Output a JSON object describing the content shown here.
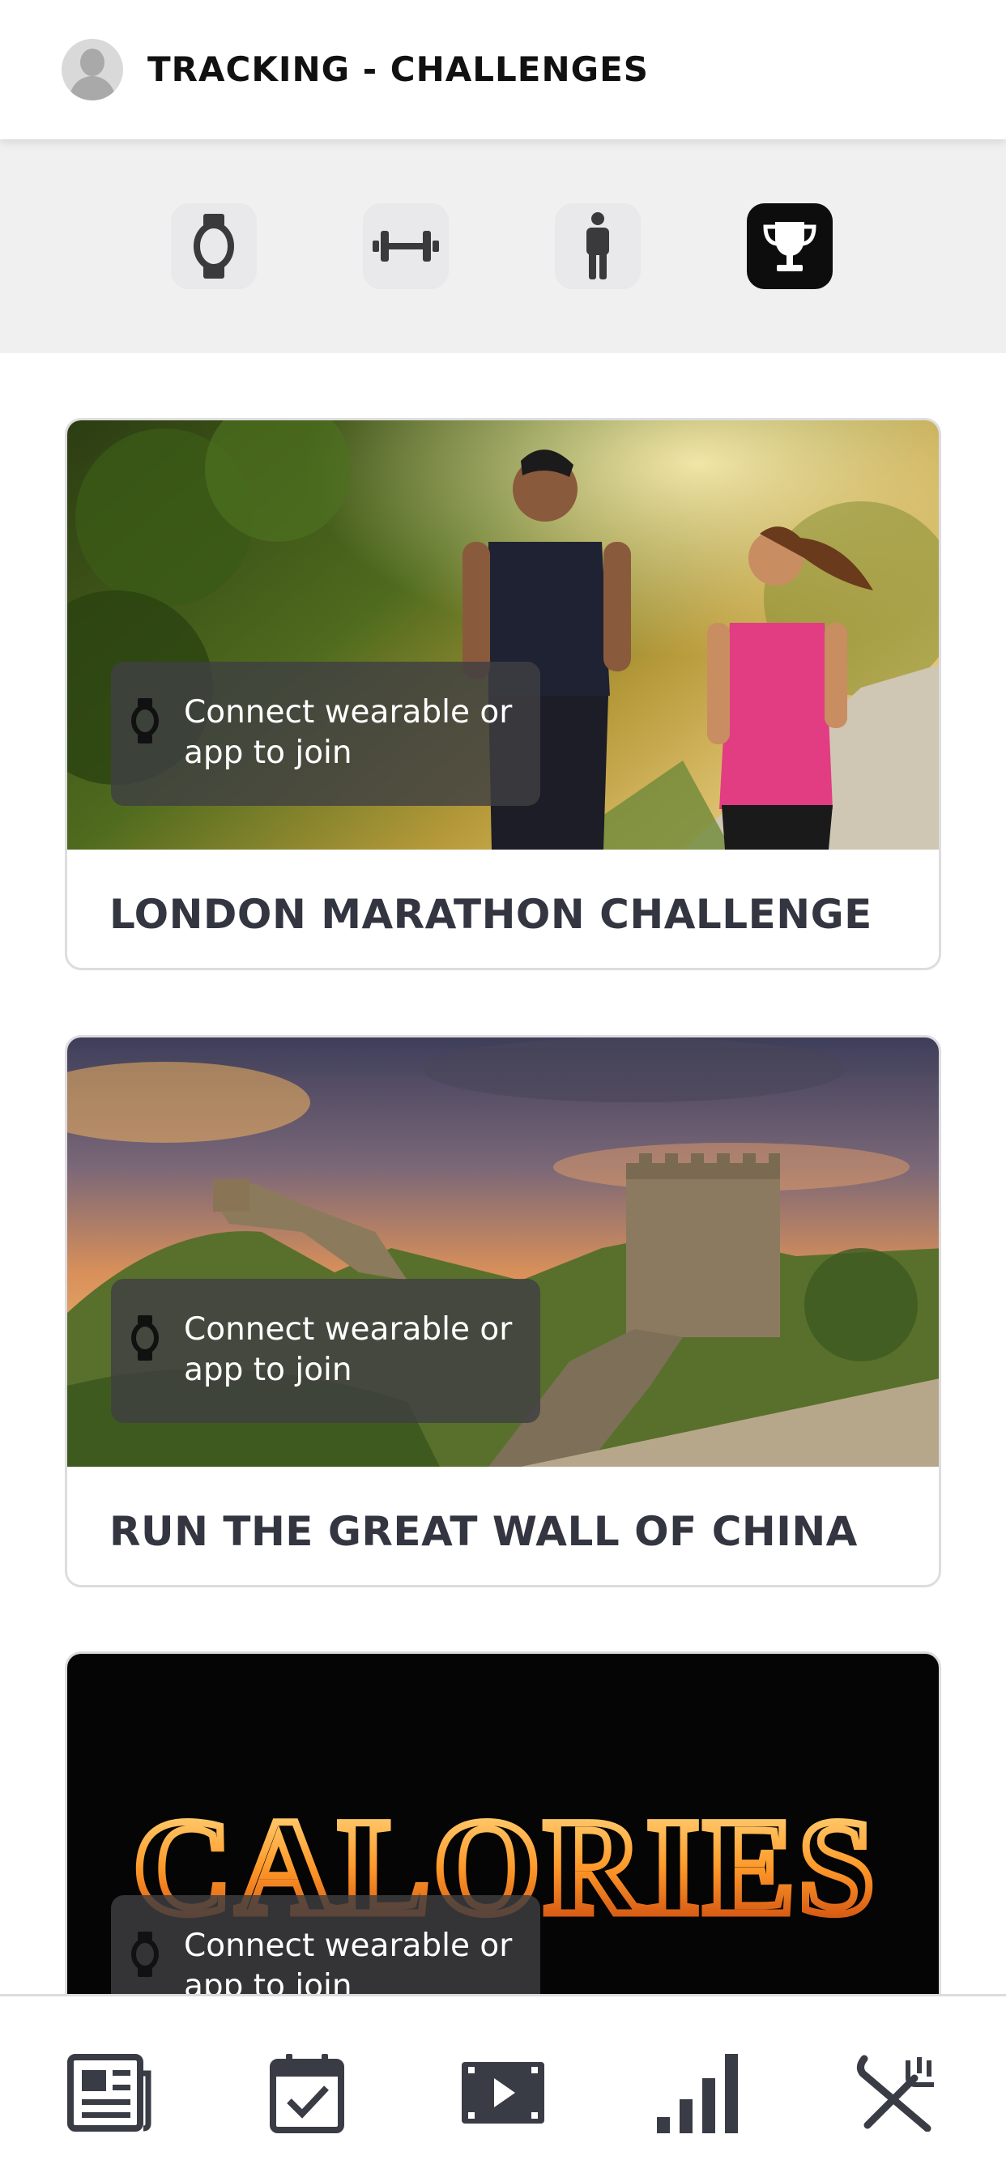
{
  "header": {
    "title": "TRACKING - CHALLENGES",
    "avatar_icon": "user-avatar-icon"
  },
  "categories": [
    {
      "icon": "watch-icon",
      "active": false
    },
    {
      "icon": "dumbbell-icon",
      "active": false
    },
    {
      "icon": "person-icon",
      "active": false
    },
    {
      "icon": "trophy-icon",
      "active": true
    }
  ],
  "challenges": [
    {
      "title": "LONDON MARATHON CHALLENGE",
      "badge_text": "Connect wearable or app to join"
    },
    {
      "title": "RUN THE GREAT WALL OF CHINA",
      "badge_text": "Connect wearable or app to join"
    },
    {
      "title": "",
      "image_text": "CALORIES",
      "badge_text": "Connect wearable or app to join"
    }
  ],
  "bottom_nav": [
    {
      "icon": "news-icon"
    },
    {
      "icon": "calendar-check-icon"
    },
    {
      "icon": "video-icon"
    },
    {
      "icon": "bar-chart-icon"
    },
    {
      "icon": "fork-knife-icon"
    }
  ],
  "colors": {
    "header_bg": "#ffffff",
    "category_bar_bg": "#f0f0f0",
    "active_category_bg": "#0d0d0d",
    "badge_bg": "#404042",
    "title_text": "#333641"
  }
}
